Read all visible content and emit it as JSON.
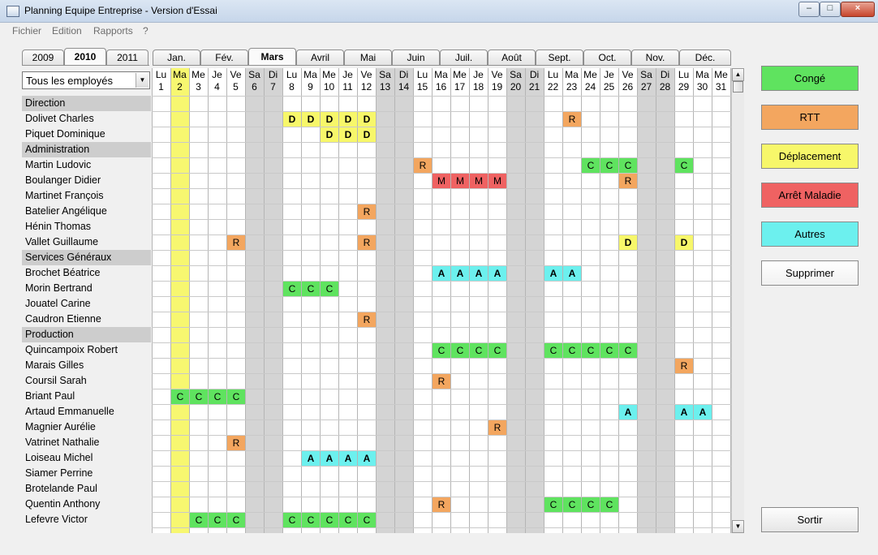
{
  "window": {
    "title": "Planning Equipe Entreprise - Version d'Essai",
    "minimize_glyph": "–",
    "maximize_glyph": "□",
    "close_glyph": "×"
  },
  "menu": [
    "Fichier",
    "Edition",
    "Rapports",
    "?"
  ],
  "years": [
    {
      "label": "2009",
      "active": false
    },
    {
      "label": "2010",
      "active": true
    },
    {
      "label": "2011",
      "active": false
    }
  ],
  "months": [
    {
      "label": "Jan.",
      "active": false
    },
    {
      "label": "Fév.",
      "active": false
    },
    {
      "label": "Mars",
      "active": true
    },
    {
      "label": "Avril",
      "active": false
    },
    {
      "label": "Mai",
      "active": false
    },
    {
      "label": "Juin",
      "active": false
    },
    {
      "label": "Juil.",
      "active": false
    },
    {
      "label": "Août",
      "active": false
    },
    {
      "label": "Sept.",
      "active": false
    },
    {
      "label": "Oct.",
      "active": false
    },
    {
      "label": "Nov.",
      "active": false
    },
    {
      "label": "Déc.",
      "active": false
    }
  ],
  "employee_filter": "Tous les employés",
  "days": [
    [
      "Lu",
      "1"
    ],
    [
      "Ma",
      "2"
    ],
    [
      "Me",
      "3"
    ],
    [
      "Je",
      "4"
    ],
    [
      "Ve",
      "5"
    ],
    [
      "Sa",
      "6"
    ],
    [
      "Di",
      "7"
    ],
    [
      "Lu",
      "8"
    ],
    [
      "Ma",
      "9"
    ],
    [
      "Me",
      "10"
    ],
    [
      "Je",
      "11"
    ],
    [
      "Ve",
      "12"
    ],
    [
      "Sa",
      "13"
    ],
    [
      "Di",
      "14"
    ],
    [
      "Lu",
      "15"
    ],
    [
      "Ma",
      "16"
    ],
    [
      "Me",
      "17"
    ],
    [
      "Je",
      "18"
    ],
    [
      "Ve",
      "19"
    ],
    [
      "Sa",
      "20"
    ],
    [
      "Di",
      "21"
    ],
    [
      "Lu",
      "22"
    ],
    [
      "Ma",
      "23"
    ],
    [
      "Me",
      "24"
    ],
    [
      "Je",
      "25"
    ],
    [
      "Ve",
      "26"
    ],
    [
      "Sa",
      "27"
    ],
    [
      "Di",
      "28"
    ],
    [
      "Lu",
      "29"
    ],
    [
      "Ma",
      "30"
    ],
    [
      "Me",
      "31"
    ]
  ],
  "highlight_day": 2,
  "rows": [
    {
      "name": "Direction",
      "group": true
    },
    {
      "name": "Dolivet Charles",
      "entries": {
        "8": "D",
        "9": "D",
        "10": "D",
        "11": "D",
        "12": "D",
        "23": "R"
      }
    },
    {
      "name": "Piquet Dominique",
      "entries": {
        "10": "D",
        "11": "D",
        "12": "D"
      }
    },
    {
      "name": "Administration",
      "group": true
    },
    {
      "name": "Martin Ludovic",
      "entries": {
        "15": "R",
        "24": "C",
        "25": "C",
        "26": "C",
        "29": "C"
      }
    },
    {
      "name": "Boulanger Didier",
      "entries": {
        "16": "M",
        "17": "M",
        "18": "M",
        "19": "M",
        "26": "R"
      }
    },
    {
      "name": "Martinet François",
      "entries": {}
    },
    {
      "name": "Batelier Angélique",
      "entries": {
        "12": "R"
      }
    },
    {
      "name": "Hénin Thomas",
      "entries": {}
    },
    {
      "name": "Vallet Guillaume",
      "entries": {
        "5": "R",
        "12": "R",
        "26": "D",
        "29": "D"
      }
    },
    {
      "name": "Services Généraux",
      "group": true
    },
    {
      "name": "Brochet Béatrice",
      "entries": {
        "16": "A",
        "17": "A",
        "18": "A",
        "19": "A",
        "22": "A",
        "23": "A"
      }
    },
    {
      "name": "Morin Bertrand",
      "entries": {
        "8": "C",
        "9": "C",
        "10": "C"
      }
    },
    {
      "name": "Jouatel Carine",
      "entries": {}
    },
    {
      "name": "Caudron Etienne",
      "entries": {
        "12": "R"
      }
    },
    {
      "name": "Production",
      "group": true
    },
    {
      "name": "Quincampoix Robert",
      "entries": {
        "16": "C",
        "17": "C",
        "18": "C",
        "19": "C",
        "22": "C",
        "23": "C",
        "24": "C",
        "25": "C",
        "26": "C"
      }
    },
    {
      "name": "Marais Gilles",
      "entries": {
        "29": "R"
      }
    },
    {
      "name": "Coursil Sarah",
      "entries": {
        "16": "R"
      }
    },
    {
      "name": "Briant Paul",
      "entries": {
        "2": "C",
        "3": "C",
        "4": "C",
        "5": "C"
      }
    },
    {
      "name": "Artaud Emmanuelle",
      "entries": {
        "26": "A",
        "29": "A",
        "30": "A"
      }
    },
    {
      "name": "Magnier Aurélie",
      "entries": {
        "19": "R"
      }
    },
    {
      "name": "Vatrinet Nathalie",
      "entries": {
        "5": "R"
      }
    },
    {
      "name": "Loiseau Michel",
      "entries": {
        "9": "A",
        "10": "A",
        "11": "A",
        "12": "A"
      }
    },
    {
      "name": "Siamer Perrine",
      "entries": {}
    },
    {
      "name": "Brotelande Paul",
      "entries": {}
    },
    {
      "name": "Quentin Anthony",
      "entries": {
        "16": "R",
        "22": "C",
        "23": "C",
        "24": "C",
        "25": "C"
      }
    },
    {
      "name": "Lefevre Victor",
      "entries": {
        "3": "C",
        "4": "C",
        "5": "C",
        "8": "C",
        "9": "C",
        "10": "C",
        "11": "C",
        "12": "C"
      }
    }
  ],
  "codes": {
    "C": {
      "color": "#5fe35f",
      "bold": false
    },
    "R": {
      "color": "#f3a65f",
      "bold": false
    },
    "D": {
      "color": "#f7f76a",
      "bold": true
    },
    "M": {
      "color": "#ef6262",
      "bold": false
    },
    "A": {
      "color": "#6cf0ee",
      "bold": true
    }
  },
  "colors": {
    "weekend": "#d4d4d4",
    "highlight": "#f7f770",
    "gridline": "#c9c9c9"
  },
  "actions": [
    {
      "name": "conge-button",
      "label": "Congé",
      "color": "#5fe35f"
    },
    {
      "name": "rtt-button",
      "label": "RTT",
      "color": "#f3a65f"
    },
    {
      "name": "deplacement-button",
      "label": "Déplacement",
      "color": "#f7f76a"
    },
    {
      "name": "arret-maladie-button",
      "label": "Arrêt Maladie",
      "color": "#ef6262"
    },
    {
      "name": "autres-button",
      "label": "Autres",
      "color": "#6cf0ee"
    },
    {
      "name": "supprimer-button",
      "label": "Supprimer",
      "color": "#ffffff"
    }
  ],
  "exit_label": "Sortir",
  "scroll": {
    "up_glyph": "▲",
    "down_glyph": "▼",
    "combo_glyph": "▼"
  }
}
